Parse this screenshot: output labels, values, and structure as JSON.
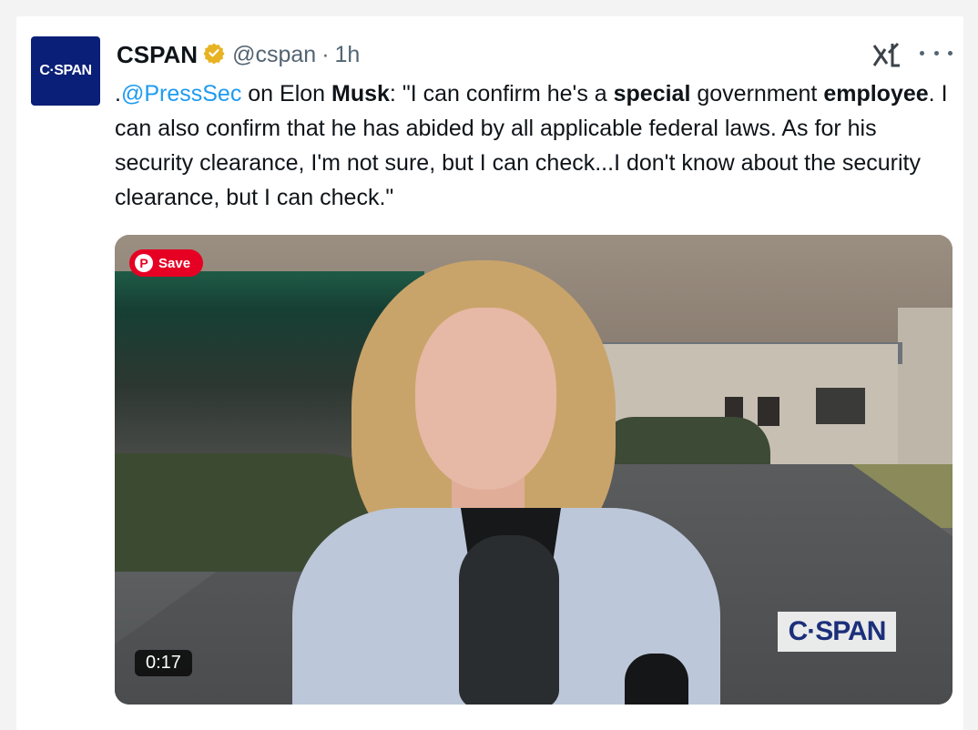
{
  "author": {
    "avatar_text": "C·SPAN",
    "name": "CSPAN",
    "handle": "@cspan",
    "separator": "·",
    "time": "1h",
    "verified_icon": "verified-badge-gold"
  },
  "header_actions": {
    "grok_icon": "grok-icon",
    "more_icon": "more-icon"
  },
  "tweet": {
    "prefix": ".",
    "mention": "@PressSec",
    "part1": " on Elon ",
    "bold1": "Musk",
    "part2": ": \"I can confirm he's a ",
    "bold2": "special",
    "part3": " government ",
    "bold3": "employee",
    "part4": ". I can also confirm that he has abided by all applicable federal laws. As for his security clearance, I'm not sure, but I can check...I don't know about the security clearance, but I can check.\""
  },
  "media": {
    "save_label": "Save",
    "watermark": "C·SPAN",
    "duration": "0:17"
  },
  "colors": {
    "mention": "#1d9bf0",
    "brand_navy": "#0a1f77",
    "pinterest_red": "#e60023",
    "verified_gold": "#f0b71d"
  }
}
